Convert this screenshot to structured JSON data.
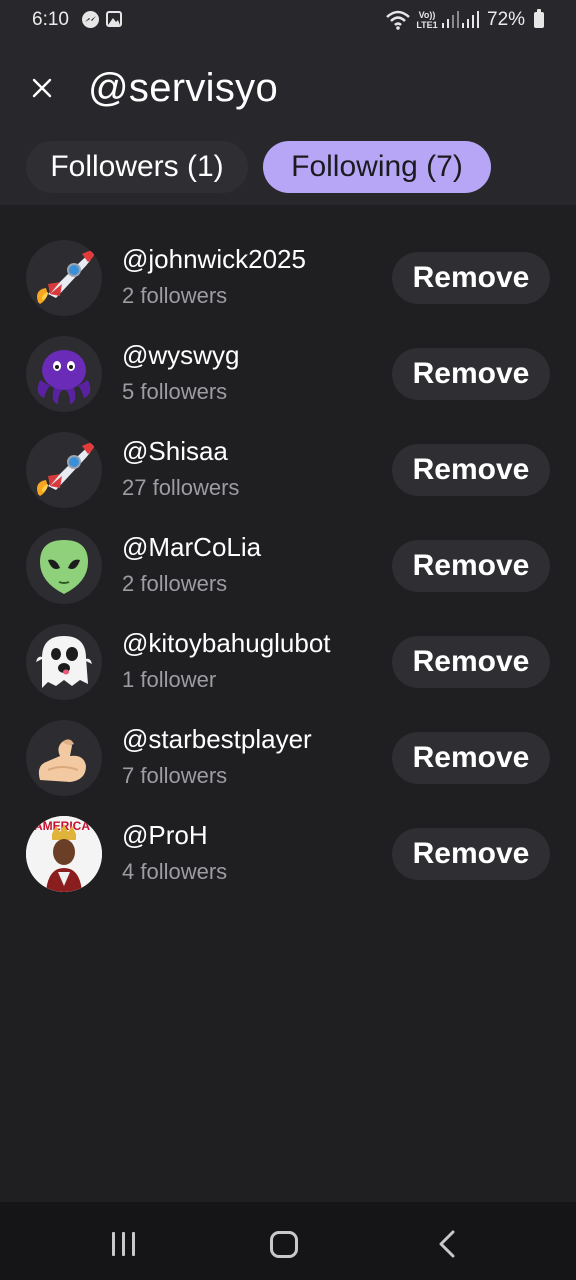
{
  "status_bar": {
    "time": "6:10",
    "network": "Vo)) LTE1",
    "battery": "72%"
  },
  "header": {
    "title": "@servisyo",
    "close_icon": "close-icon"
  },
  "tabs": [
    {
      "label": "Followers (1)",
      "selected": false
    },
    {
      "label": "Following (7)",
      "selected": true
    }
  ],
  "following": [
    {
      "handle": "@johnwick2025",
      "followers": "2 followers",
      "avatar": "rocket-emoji"
    },
    {
      "handle": "@wyswyg",
      "followers": "5 followers",
      "avatar": "purple-octopus-emoji"
    },
    {
      "handle": "@Shisaa",
      "followers": "27 followers",
      "avatar": "rocket-emoji"
    },
    {
      "handle": "@MarCoLia",
      "followers": "2 followers",
      "avatar": "alien-emoji"
    },
    {
      "handle": "@kitoybahuglubot",
      "followers": "1 follower",
      "avatar": "ghost-emoji"
    },
    {
      "handle": "@starbestplayer",
      "followers": "7 followers",
      "avatar": "flexed-biceps-emoji"
    },
    {
      "handle": "@ProH",
      "followers": "4 followers",
      "avatar": "photo-avatar",
      "avatar_text": "AMERICA"
    }
  ],
  "remove_label": "Remove",
  "colors": {
    "background": "#1f1f21",
    "header": "#28282c",
    "selected_tab": "#b7a6f6",
    "pill": "#2e2e33",
    "muted_text": "#9c9ca2"
  }
}
